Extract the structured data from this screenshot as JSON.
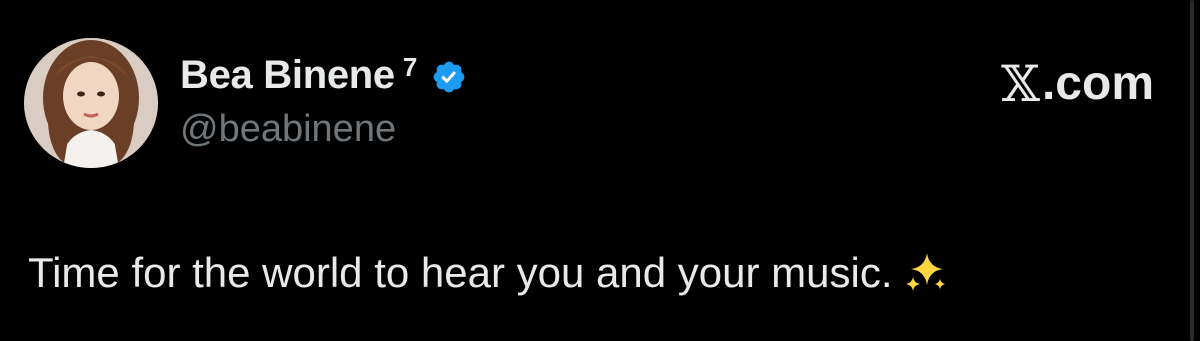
{
  "tweet": {
    "author": {
      "display_name": "Bea Binene",
      "superscript": "7",
      "handle": "@beabinene",
      "verified": true,
      "verified_color": "#1d9bf0"
    },
    "brand": {
      "x_glyph": "𝕏",
      "domain_text": ".com"
    },
    "text": "Time for the world to hear you and your music.",
    "emoji_icon": "sparkles-icon"
  },
  "colors": {
    "background": "#000000",
    "primary_text": "#e7e9ea",
    "secondary_text": "#71767b",
    "accent": "#1d9bf0"
  }
}
